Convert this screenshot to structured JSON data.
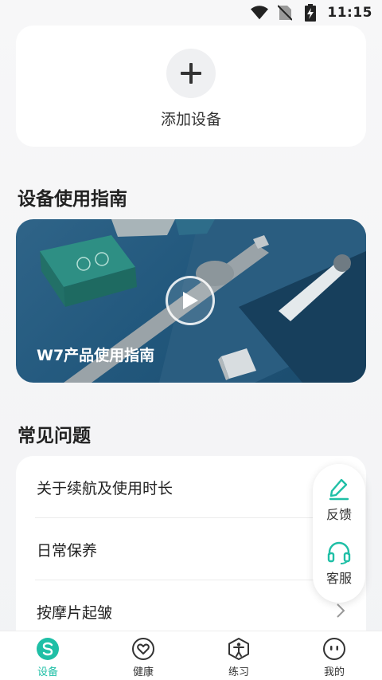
{
  "status_bar": {
    "time": "11:15"
  },
  "add_device": {
    "label": "添加设备"
  },
  "guide_section": {
    "title": "设备使用指南",
    "video_title": "W7产品使用指南"
  },
  "faq_section": {
    "title": "常见问题",
    "items": [
      {
        "label": "关于续航及使用时长"
      },
      {
        "label": "日常保养"
      },
      {
        "label": "按摩片起皱"
      }
    ]
  },
  "floating_actions": {
    "feedback": "反馈",
    "service": "客服"
  },
  "tabs": [
    {
      "label": "设备",
      "icon": "device-icon",
      "active": true
    },
    {
      "label": "健康",
      "icon": "heart-icon",
      "active": false
    },
    {
      "label": "练习",
      "icon": "exercise-icon",
      "active": false
    },
    {
      "label": "我的",
      "icon": "profile-icon",
      "active": false
    }
  ],
  "colors": {
    "accent": "#1fbfa6",
    "card": "#ffffff",
    "background": "#f4f5f7"
  }
}
